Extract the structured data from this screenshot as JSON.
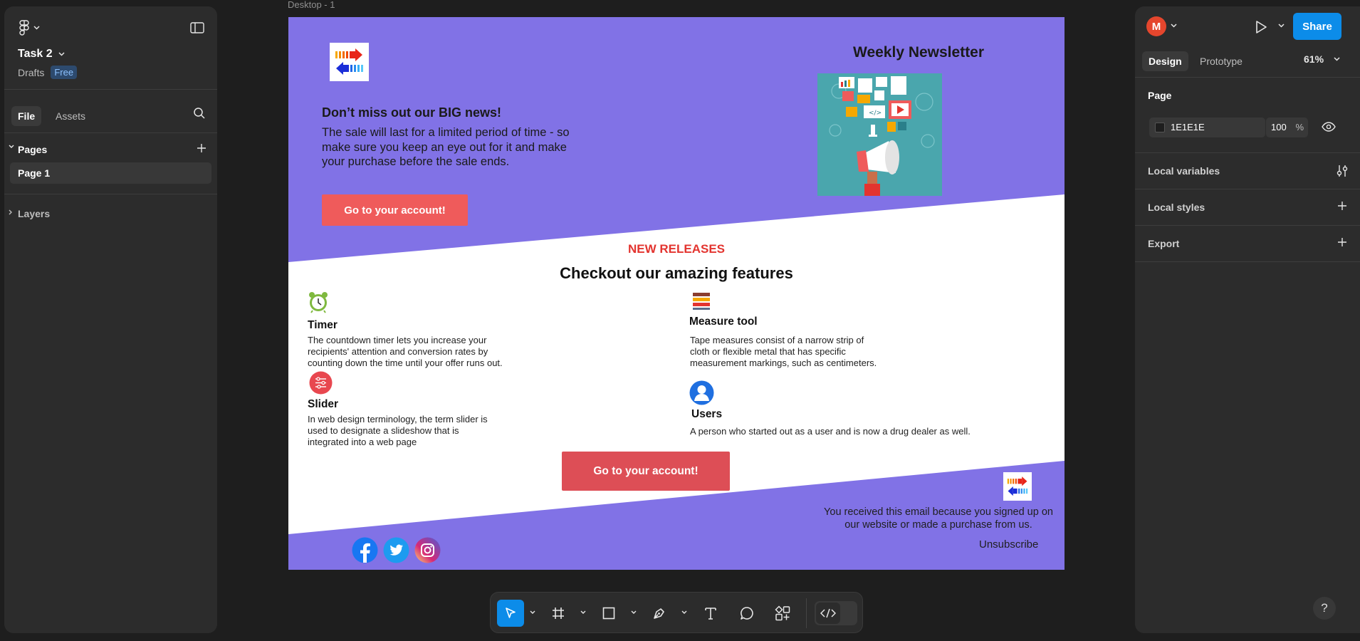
{
  "left_panel": {
    "file_name": "Task 2",
    "location": "Drafts",
    "plan": "Free",
    "tabs": [
      "File",
      "Assets"
    ],
    "pages_label": "Pages",
    "pages": [
      "Page 1"
    ],
    "layers_label": "Layers"
  },
  "right_panel": {
    "avatar_initial": "M",
    "share_label": "Share",
    "tabs": [
      "Design",
      "Prototype"
    ],
    "zoom": "61%",
    "page_section": "Page",
    "page_fill": "1E1E1E",
    "page_opacity": "100",
    "opacity_unit": "%",
    "local_variables": "Local variables",
    "local_styles": "Local styles",
    "export": "Export",
    "help": "?"
  },
  "canvas": {
    "frame_label": "Desktop - 1",
    "newsletter": {
      "title": "Weekly Newsletter",
      "hero_heading": "Don’t miss out our BIG news!",
      "hero_text": "The sale will last for a limited period of time - so make sure you keep an eye out for it and make your purchase before the sale ends.",
      "cta_top": "Go to your account!",
      "releases_label": "NEW RELEASES",
      "features_title": "Checkout our amazing features",
      "features": [
        {
          "title": "Timer",
          "text": "The countdown timer lets you increase your recipients' attention and conversion rates by counting down the time until your offer runs out.",
          "icon": "alarm-clock-icon"
        },
        {
          "title": "Measure tool",
          "text": "Tape measures consist of a narrow strip of cloth or flexible metal that has specific measurement markings, such as centimeters.",
          "icon": "measure-stack-icon"
        },
        {
          "title": "Slider",
          "text": "In web design terminology, the term slider is used to designate a slideshow that is integrated into a web page",
          "icon": "sliders-icon"
        },
        {
          "title": "Users",
          "text": "A person who started out as a user and is now a drug dealer as well.",
          "icon": "user-icon"
        }
      ],
      "cta_bottom": "Go to your account!",
      "footer_text": "You received this email because you signed up on our website or made a purchase from us.",
      "unsubscribe": "Unsubscribe",
      "social": [
        "facebook-icon",
        "twitter-icon",
        "instagram-icon"
      ],
      "colors": {
        "band": "#8172e6",
        "cta": "#ef5b5b",
        "accent_red": "#e3342f"
      }
    }
  },
  "toolbar": {
    "tools": [
      "move-tool",
      "frame-tool",
      "rectangle-tool",
      "pen-tool",
      "text-tool",
      "comment-tool",
      "actions-tool"
    ],
    "dev_mode": "dev-mode-toggle"
  }
}
